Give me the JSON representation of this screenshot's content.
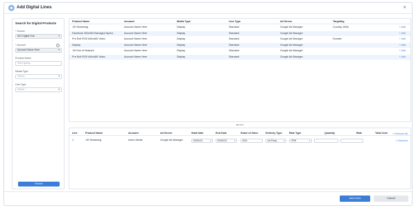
{
  "dialog": {
    "title": "Add Digital Lines",
    "close_glyph": "×",
    "header_icon": "add-lines-icon"
  },
  "search_panel": {
    "title": "Search for Digital Products",
    "source": {
      "label": "Source",
      "required": "*",
      "value": "WO Digital Hub"
    },
    "account": {
      "label": "Account",
      "required": "*",
      "value": "Account Name Here",
      "info_glyph": "i"
    },
    "product_name": {
      "label": "Product Name",
      "placeholder": "Start typing..."
    },
    "media_type": {
      "label": "Media Type",
      "placeholder": "Select..."
    },
    "line_type": {
      "label": "Line Type",
      "placeholder": "Select..."
    },
    "search_button": "Search",
    "caret_glyph": "▾"
  },
  "products": {
    "columns": [
      "Product Name",
      "Account",
      "Media Type",
      "Line Type",
      "Ad Server",
      "Targeting"
    ],
    "add_label": "+ Add",
    "rows": [
      {
        "product": ":30 Streaming",
        "account": "Account Name Here",
        "media": "Display",
        "line": "Standard",
        "server": "Google Ad Manager",
        "targeting": "Country, DMA"
      },
      {
        "product": "Facebook 300x250 Managed Spend",
        "account": "Account Name Here",
        "media": "Display",
        "line": "Standard",
        "server": "Google Ad Manager",
        "targeting": ""
      },
      {
        "product": "Pre Roll ROS 640x480 Video",
        "account": "Account Name Here",
        "media": "Display",
        "line": "Standard",
        "server": "Google Ad Manager",
        "targeting": "Domain"
      },
      {
        "product": "Display",
        "account": "Account Name Here",
        "media": "Display",
        "line": "Standard",
        "server": "Google Ad Manager",
        "targeting": ""
      },
      {
        "product": ":30 Run of Network",
        "account": "Account Name Here",
        "media": "Display",
        "line": "Standard",
        "server": "Google Ad Manager",
        "targeting": ""
      },
      {
        "product": "Pre Roll ROS 640x480 Video",
        "account": "Account Name Here",
        "media": "Display",
        "line": "Standard",
        "server": "Google Ad Manager",
        "targeting": ""
      }
    ]
  },
  "lines": {
    "columns": {
      "line": "Line",
      "product": "Product Name",
      "account": "Account",
      "server": "Ad Server",
      "start": "Start Date",
      "end": "End Date",
      "share": "Share of Voice",
      "delivery": "Delivery Type",
      "rate_type": "Rate Type",
      "quantity": "Quantity",
      "rate": "Rate",
      "total": "Total Cost"
    },
    "remove_all": "Remove All",
    "remove": "Remove",
    "remove_glyph": "×",
    "rows": [
      {
        "line": "1",
        "product": ":30 Streaming",
        "account": "Acme Media",
        "server": "Google Ad Manager",
        "start": "00/00/24",
        "end": "00/00/24",
        "share": "30%",
        "delivery": "1st Party",
        "rate_type": "CPM",
        "quantity": "",
        "rate": ""
      }
    ]
  },
  "footer": {
    "add_button": "Add Lines",
    "cancel_button": "Cancel"
  },
  "colors": {
    "accent": "#3b7dd8",
    "row_alt": "#eef4fb",
    "required": "#d93025"
  }
}
